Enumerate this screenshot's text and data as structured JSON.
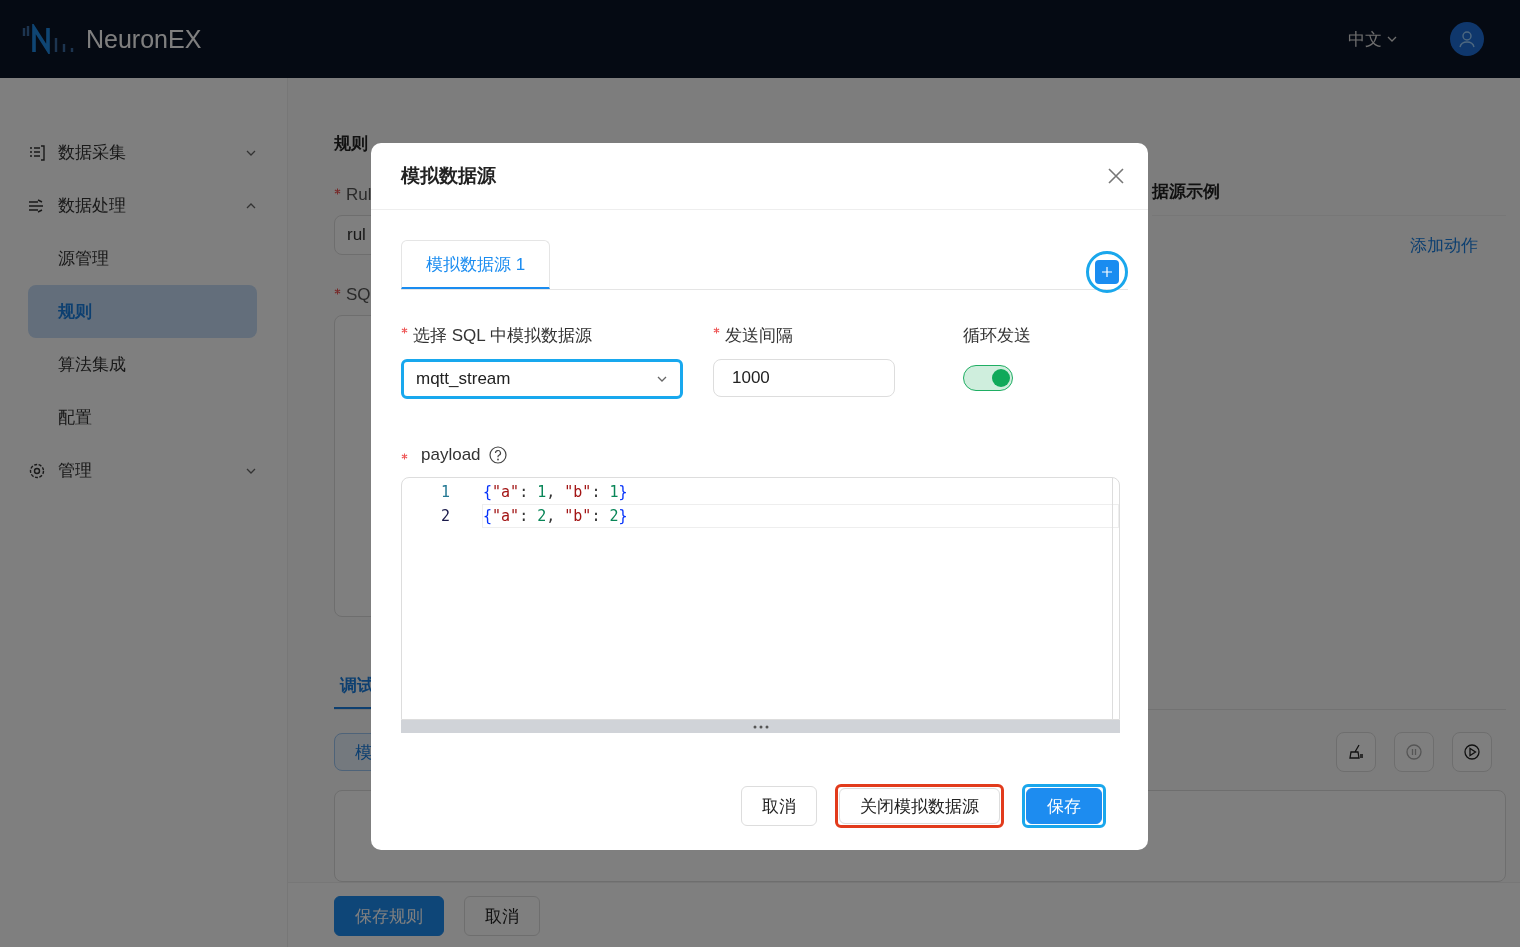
{
  "header": {
    "brand": "NeuronEX",
    "language": "中文"
  },
  "sidebar": {
    "items": [
      {
        "label": "数据采集",
        "expanded": false
      },
      {
        "label": "数据处理",
        "expanded": true,
        "children": [
          {
            "label": "源管理",
            "selected": false
          },
          {
            "label": "规则",
            "selected": true
          },
          {
            "label": "算法集成",
            "selected": false
          },
          {
            "label": "配置",
            "selected": false
          }
        ]
      },
      {
        "label": "管理",
        "expanded": false
      }
    ]
  },
  "page": {
    "breadcrumb": [
      "规则"
    ],
    "name_label": "Rul",
    "name_required": true,
    "name_value": "rul",
    "sql_label": "SQ",
    "sql_required": true,
    "side_title": "据源示例",
    "side_link": "添加动作",
    "debug_tab": "调试",
    "debug_button": "模",
    "toolbar": [
      {
        "kind": "clear",
        "disabled": false
      },
      {
        "kind": "pause",
        "disabled": true
      },
      {
        "kind": "play",
        "disabled": false
      }
    ],
    "footer_buttons": [
      {
        "label": "保存规则",
        "kind": "primary"
      },
      {
        "label": "取消",
        "kind": "default"
      }
    ]
  },
  "dialog": {
    "title": "模拟数据源",
    "tabs": [
      {
        "label": "模拟数据源 1",
        "selected": true
      }
    ],
    "add_button": {
      "color": "#1aa7ec"
    },
    "fields": [
      {
        "kind": "select",
        "label": "选择 SQL 中模拟数据源",
        "required": true,
        "value": "mqtt_stream"
      },
      {
        "kind": "input",
        "label": "发送间隔",
        "required": true,
        "value": "1000"
      },
      {
        "kind": "switch",
        "label": "循环发送",
        "required": false,
        "on": true
      }
    ],
    "payload": {
      "label": "payload",
      "required": true,
      "lines": [
        {
          "number": "1",
          "text": "{\"a\": 1, \"b\": 1}",
          "current": false
        },
        {
          "number": "2",
          "text": "{\"a\": 2, \"b\": 2}",
          "current": true
        }
      ]
    },
    "buttons": [
      {
        "label": "取消",
        "kind": "default"
      },
      {
        "label": "关闭模拟数据源",
        "kind": "default",
        "color": "#e23b1c"
      },
      {
        "label": "保存",
        "kind": "primary",
        "color": "#1aa7ec"
      }
    ]
  }
}
